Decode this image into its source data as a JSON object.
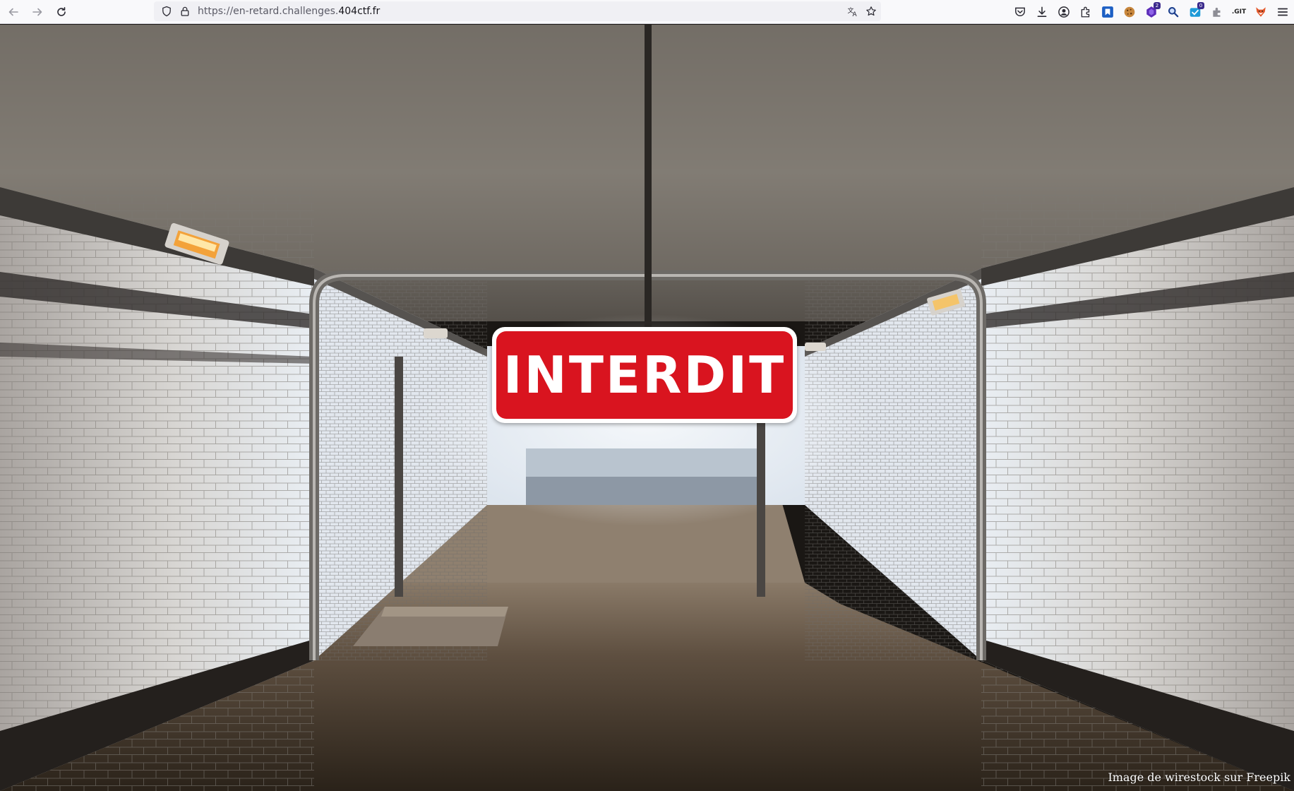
{
  "browser": {
    "url_prefix": "https://en-retard.challenges.",
    "url_domain": "404ctf.fr",
    "extensions": [
      {
        "name": "pocket-icon"
      },
      {
        "name": "download-icon"
      },
      {
        "name": "account-icon"
      },
      {
        "name": "extensions-icon"
      },
      {
        "name": "ext-blue-square-icon"
      },
      {
        "name": "cookie-icon"
      },
      {
        "name": "ext-purple-icon",
        "badge": "2"
      },
      {
        "name": "magnifier-icon"
      },
      {
        "name": "ext-badge-icon",
        "badge": "0"
      },
      {
        "name": "puzzle-gray-icon"
      },
      {
        "name": "git-icon",
        "label": ".GIT"
      },
      {
        "name": "fox-icon"
      },
      {
        "name": "menu-icon"
      }
    ]
  },
  "page": {
    "sign_text": "INTERDIT",
    "credit": "Image de wirestock sur Freepik",
    "colors": {
      "sign_red": "#d9141f",
      "sign_border": "#ffffff"
    }
  }
}
